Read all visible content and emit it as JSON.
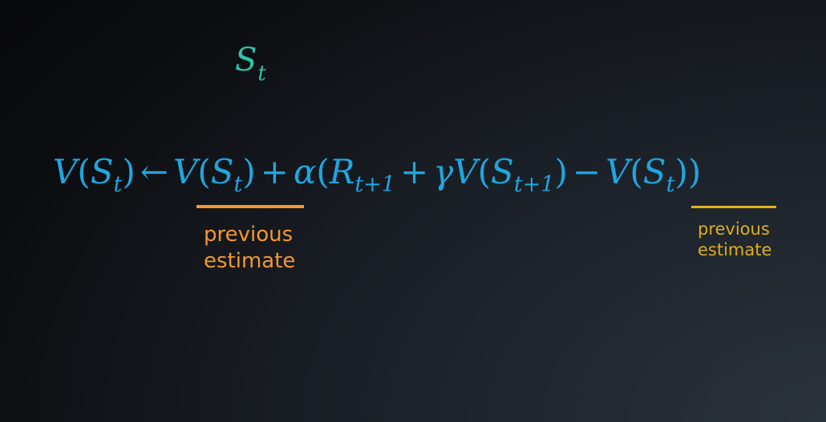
{
  "state_label": {
    "symbol": "S",
    "subscript": "t"
  },
  "equation": {
    "lhs_fn": "V",
    "lhs_open": "(",
    "lhs_var": "S",
    "lhs_sub": "t",
    "lhs_close": ")",
    "arrow": "←",
    "term1_fn": "V",
    "term1_open": "(",
    "term1_var": "S",
    "term1_sub": "t",
    "term1_close": ")",
    "plus1": "+",
    "alpha": "α",
    "open_paren": "(",
    "reward": "R",
    "reward_sub": "t+1",
    "plus2": "+",
    "gamma": "γ",
    "term2_fn": "V",
    "term2_open": "(",
    "term2_var": "S",
    "term2_sub": "t+1",
    "term2_close": ")",
    "minus": "−",
    "term3_fn": "V",
    "term3_open": "(",
    "term3_var": "S",
    "term3_sub": "t",
    "term3_close": ")",
    "close_paren": ")"
  },
  "annotations": {
    "left": {
      "line1": "previous",
      "line2": "estimate",
      "color": "#f5972f"
    },
    "right": {
      "line1": "previous",
      "line2": "estimate",
      "color": "#dcae1e"
    }
  },
  "colors": {
    "equation": "#1fa6df",
    "state_label": "#2fc4a8"
  }
}
